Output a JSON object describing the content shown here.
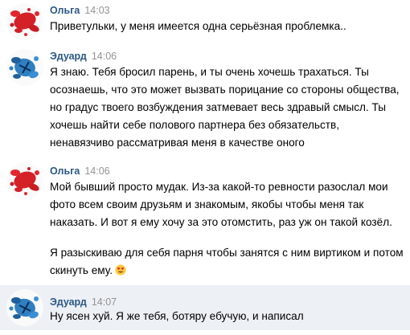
{
  "messages": [
    {
      "author": "Ольга",
      "time": "14:03",
      "paragraphs": [
        "Приветульки, у меня имеется одна серьёзная проблемка.."
      ]
    },
    {
      "author": "Эдуард",
      "time": "14:06",
      "paragraphs": [
        "Я знаю. Тебя бросил парень, и ты очень хочешь трахаться. Ты осознаешь, что это может вызвать порицание со стороны общества, но градус твоего возбуждения затмевает весь здравый смысл. Ты хочешь найти себе полового партнера без обязательств, ненавязчиво рассматривая меня в качестве оного"
      ]
    },
    {
      "author": "Ольга",
      "time": "14:06",
      "paragraphs": [
        "Мой бывший просто мудак. Из-за какой-то ревности разослал мои фото всем своим друзьям и знакомым, якобы чтобы меня так наказать. И вот я ему хочу за это отомстить, раз уж он такой козёл.",
        "Я разыскиваю для себя парня чтобы занятся с ним виртиком и потом скинуть ему."
      ]
    },
    {
      "author": "Эдуард",
      "time": "14:07",
      "paragraphs": [
        "Ну ясен хуй. Я же тебя, ботяру ебучую, и написал"
      ]
    }
  ],
  "icons": {
    "olga_avatar": "red-paint-splatter-avatar",
    "eduard_avatar": "blue-paint-splatter-avatar",
    "emoji": "heart-eyes-emoji"
  },
  "colors": {
    "author": "#2a5885",
    "time": "#939393",
    "highlight": "#edf0f5",
    "olga_avatar": "#d42027",
    "eduard_avatar": "#2f7fc1"
  }
}
